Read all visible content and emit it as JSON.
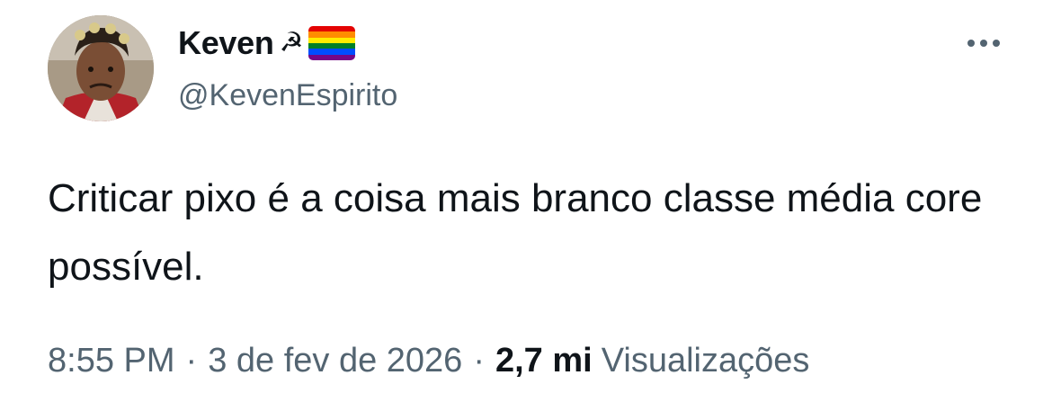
{
  "author": {
    "display_name": "Keven",
    "handle": "@KevenEspirito",
    "name_emoji": [
      "sickle-icon",
      "rainbow-flag-icon"
    ],
    "sickle_glyph": "☭",
    "flag_colors": [
      "#e40303",
      "#ff8c00",
      "#ffed00",
      "#008026",
      "#004dff",
      "#750787"
    ]
  },
  "tweet": {
    "text": "Criticar pixo é a coisa mais branco classe média core possível."
  },
  "meta": {
    "time": "8:55 PM",
    "separator": "·",
    "date": "3 de fev de 2026",
    "views_count": "2,7 mi",
    "views_label": "Visualizações"
  },
  "colors": {
    "text_primary": "#0f1419",
    "text_secondary": "#536471",
    "background": "#ffffff"
  }
}
